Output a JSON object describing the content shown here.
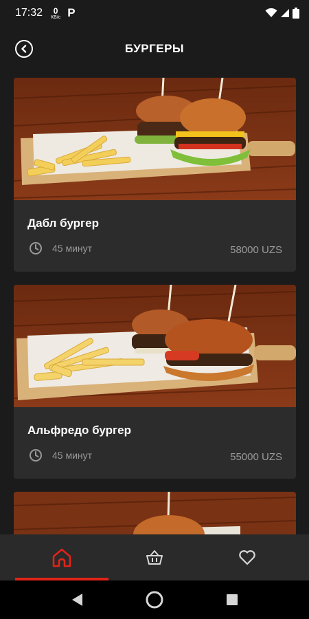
{
  "status_bar": {
    "time": "17:32",
    "data_speed_value": "0",
    "data_speed_unit": "КВ/с",
    "parking_icon_letter": "P"
  },
  "header": {
    "title": "БУРГЕРЫ"
  },
  "items": [
    {
      "name": "Дабл бургер",
      "time": "45 минут",
      "price": "58000 UZS"
    },
    {
      "name": "Альфредо бургер",
      "time": "45 минут",
      "price": "55000 UZS"
    }
  ],
  "bottom_nav": {
    "items": [
      {
        "icon": "home-icon",
        "active": true
      },
      {
        "icon": "basket-icon",
        "active": false
      },
      {
        "icon": "heart-icon",
        "active": false
      }
    ],
    "accent_color": "#e2231a"
  },
  "colors": {
    "background": "#1b1b1b",
    "card": "#2c2c2c",
    "muted_text": "#9a9a9a",
    "accent": "#e2231a"
  }
}
